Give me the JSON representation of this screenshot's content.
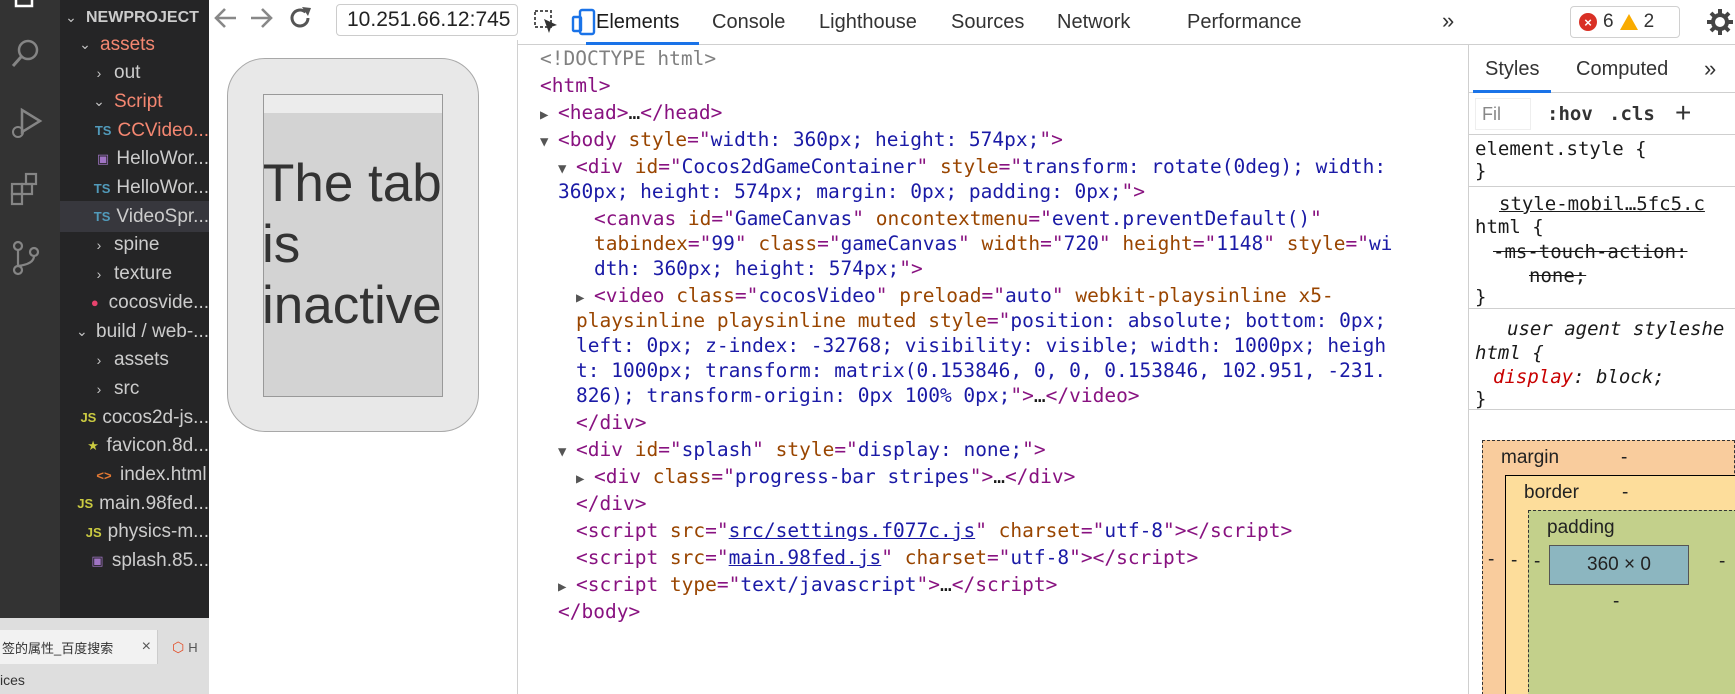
{
  "vscode": {
    "explorer_title": "NEWPROJECT",
    "tree": [
      {
        "label": "assets",
        "chevron": "down",
        "indent": 0,
        "color": "red"
      },
      {
        "label": "out",
        "chevron": "right",
        "indent": 1,
        "color": "default"
      },
      {
        "label": "Script",
        "chevron": "down",
        "indent": 1,
        "color": "red"
      },
      {
        "label": "CCVideo...",
        "badge": "TS",
        "indent": 2,
        "color": "red"
      },
      {
        "label": "HelloWor...",
        "badge": "img",
        "indent": 2,
        "color": "default"
      },
      {
        "label": "HelloWor...",
        "badge": "TS",
        "indent": 2,
        "color": "default"
      },
      {
        "label": "VideoSpr...",
        "badge": "TS",
        "indent": 2,
        "color": "default",
        "selected": true
      },
      {
        "label": "spine",
        "chevron": "right",
        "indent": 1,
        "color": "default"
      },
      {
        "label": "texture",
        "chevron": "right",
        "indent": 1,
        "color": "default"
      },
      {
        "label": "cocosvide...",
        "badge": "cocos",
        "indent": 1,
        "color": "default"
      },
      {
        "label": "build / web-...",
        "chevron": "down",
        "indent": 0,
        "color": "default"
      },
      {
        "label": "assets",
        "chevron": "right",
        "indent": 1,
        "color": "default"
      },
      {
        "label": "src",
        "chevron": "right",
        "indent": 1,
        "color": "default"
      },
      {
        "label": "cocos2d-js...",
        "badge": "JS",
        "indent": 1,
        "color": "default"
      },
      {
        "label": "favicon.8d...",
        "badge": "star",
        "indent": 1,
        "color": "default"
      },
      {
        "label": "index.html",
        "badge": "html",
        "indent": 1,
        "color": "default"
      },
      {
        "label": "main.98fed...",
        "badge": "JS",
        "indent": 1,
        "color": "default"
      },
      {
        "label": "physics-m...",
        "badge": "JS",
        "indent": 1,
        "color": "default"
      },
      {
        "label": "splash.85...",
        "badge": "img",
        "indent": 1,
        "color": "default"
      }
    ],
    "tabstrip": {
      "tab1_label": "签的属性_百度搜索",
      "tab2_label": "H",
      "bottom_text": "ices"
    }
  },
  "browser": {
    "url": "10.251.66.12:745",
    "inactive_message": "The tab is inactive"
  },
  "devtools": {
    "tabs": [
      "Elements",
      "Console",
      "Lighthouse",
      "Sources",
      "Network",
      "Performance"
    ],
    "active_tab": "Elements",
    "more_label": "»",
    "error_count": "6",
    "warning_count": "2",
    "styles_tabs": [
      "Styles",
      "Computed"
    ],
    "styles_more": "»",
    "filter_placeholder": "Fil",
    "hov_label": ":hov",
    "cls_label": ".cls",
    "plus_label": "+",
    "rules": {
      "element_style_selector": "element.style {",
      "element_style_close": "}",
      "mobile_source": "style-mobil…5fc5.c",
      "mobile_selector": "html {",
      "mobile_prop": "-ms-touch-action:",
      "mobile_value": "none;",
      "mobile_close": "}",
      "ua_label": "user agent styleshe",
      "ua_selector": "html {",
      "ua_prop": "display",
      "ua_value": ": block;",
      "ua_close": "}"
    },
    "box_model": {
      "margin_label": "margin",
      "margin_value": "-",
      "border_label": "border",
      "border_value": "-",
      "padding_label": "padding",
      "padding_value": "-",
      "content": "360 × 0",
      "side_dash": "-"
    }
  }
}
